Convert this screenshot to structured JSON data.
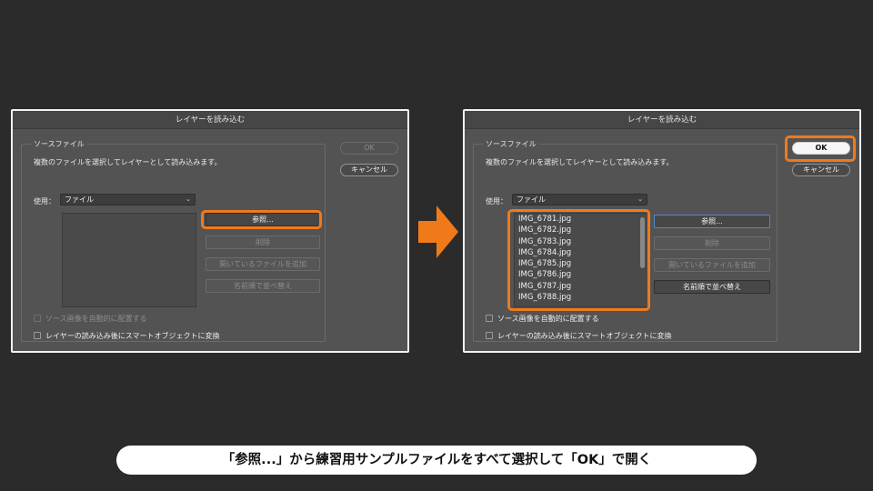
{
  "accent_color": "#f07a1a",
  "left_dialog": {
    "title": "レイヤーを読み込む",
    "source_legend": "ソースファイル",
    "description": "複数のファイルを選択してレイヤーとして読み込みます。",
    "use_label": "使用：",
    "use_value": "ファイル",
    "browse_label": "参照...",
    "remove_label": "削除",
    "add_open_label": "開いているファイルを追加",
    "sort_label": "名前順で並べ替え",
    "ok_label": "OK",
    "cancel_label": "キャンセル",
    "checkbox_align": "ソース画像を自動的に配置する",
    "checkbox_smart": "レイヤーの読み込み後にスマートオブジェクトに変換"
  },
  "right_dialog": {
    "title": "レイヤーを読み込む",
    "source_legend": "ソースファイル",
    "description": "複数のファイルを選択してレイヤーとして読み込みます。",
    "use_label": "使用：",
    "use_value": "ファイル",
    "files": [
      "IMG_6781.jpg",
      "IMG_6782.jpg",
      "IMG_6783.jpg",
      "IMG_6784.jpg",
      "IMG_6785.jpg",
      "IMG_6786.jpg",
      "IMG_6787.jpg",
      "IMG_6788.jpg"
    ],
    "browse_label": "参照...",
    "remove_label": "削除",
    "add_open_label": "開いているファイルを追加",
    "sort_label": "名前順で並べ替え",
    "ok_label": "OK",
    "cancel_label": "キャンセル",
    "checkbox_align": "ソース画像を自動的に配置する",
    "checkbox_smart": "レイヤーの読み込み後にスマートオブジェクトに変換"
  },
  "caption": "「参照...」から練習用サンプルファイルをすべて選択して「OK」で開く"
}
